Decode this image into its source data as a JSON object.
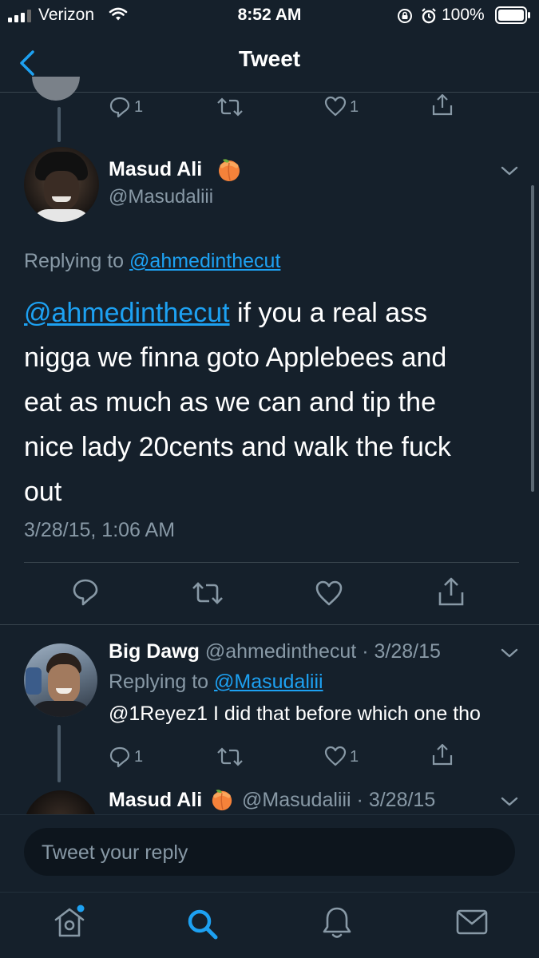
{
  "status_bar": {
    "carrier": "Verizon",
    "time": "8:52 AM",
    "battery": "100%"
  },
  "nav": {
    "title": "Tweet",
    "back_icon": "chevron-left-icon"
  },
  "prev_tweet": {
    "reply_count": "1",
    "like_count": "1"
  },
  "main_tweet": {
    "name": "Masud Ali",
    "emoji": "peach-emoji",
    "handle": "@Masudaliii",
    "replying_label": "Replying to",
    "replying_to": "@ahmedinthecut",
    "text_mention": "@ahmedinthecut",
    "text_line1": " if you a real ass",
    "text_line2": "nigga we finna goto Applebees and",
    "text_line3": "eat as much as we can and tip the",
    "text_line4": "nice lady 20cents and walk the fuck",
    "text_line5": "out",
    "timestamp": "3/28/15, 1:06 AM"
  },
  "reply_tweet": {
    "name": "Big Dawg",
    "handle": "@ahmedinthecut",
    "sep": " · ",
    "date": "3/28/15",
    "replying_label": "Replying to",
    "replying_to": "@Masudaliii",
    "text": "@1Reyez1 I did that before which one tho",
    "reply_count": "1",
    "like_count": "1"
  },
  "next_tweet": {
    "name": "Masud Ali",
    "handle": "@Masudaliii",
    "sep": " · ",
    "date": "3/28/15"
  },
  "composer": {
    "placeholder": "Tweet your reply"
  },
  "tabbar": {
    "items": [
      "home-icon",
      "search-icon",
      "notifications-icon",
      "messages-icon"
    ],
    "active": "search-icon"
  },
  "colors": {
    "background": "#15202b",
    "accent": "#1da1f2",
    "muted": "#8899a6",
    "border": "#38444d"
  }
}
